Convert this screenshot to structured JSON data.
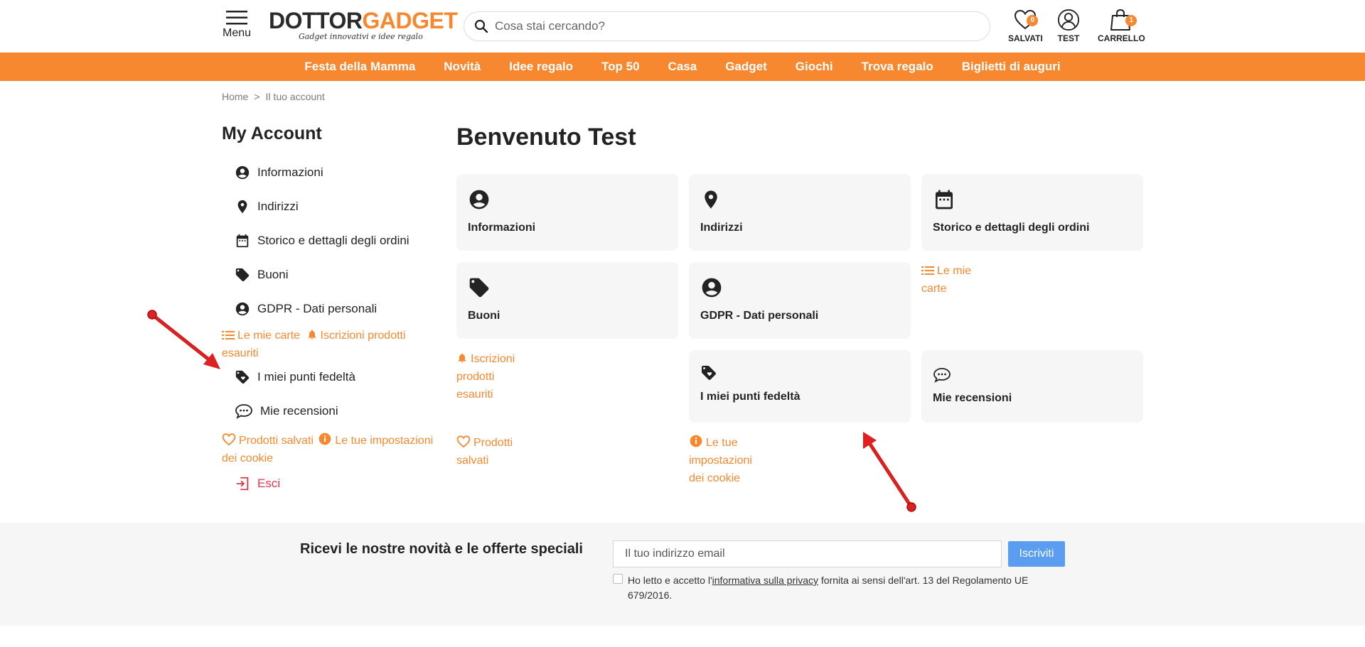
{
  "header": {
    "menu_label": "Menu",
    "logo": {
      "part1": "DOTTOR",
      "part2": "GADGET",
      "tagline": "Gadget innovativi e idee regalo"
    },
    "search_placeholder": "Cosa stai cercando?",
    "saved": {
      "label": "SALVATI",
      "count": "0"
    },
    "account": {
      "label": "TEST"
    },
    "cart": {
      "label": "CARRELLO",
      "count": "1"
    }
  },
  "nav": {
    "items": [
      "Festa della Mamma",
      "Novità",
      "Idee regalo",
      "Top 50",
      "Casa",
      "Gadget",
      "Giochi",
      "Trova regalo",
      "Biglietti di auguri"
    ]
  },
  "breadcrumb": {
    "home": "Home",
    "separator": ">",
    "current": "Il tuo account"
  },
  "sidebar": {
    "title": "My Account",
    "items": [
      {
        "label": "Informazioni",
        "icon": "account-circle-icon"
      },
      {
        "label": "Indirizzi",
        "icon": "location-pin-icon"
      },
      {
        "label": "Storico e dettagli degli ordini",
        "icon": "calendar-icon"
      },
      {
        "label": "Buoni",
        "icon": "tag-icon"
      },
      {
        "label": "GDPR - Dati personali",
        "icon": "account-circle-icon"
      }
    ],
    "cards_link": "Le mie carte",
    "subscriptions_link": "Iscrizioni prodotti esauriti",
    "loyalty": "I miei punti fedeltà",
    "reviews": "Mie recensioni",
    "saved_products": "Prodotti salvati",
    "cookie_settings": "Le tue impostazioni dei cookie",
    "logout": "Esci"
  },
  "main": {
    "welcome": "Benvenuto Test",
    "cards": {
      "info": "Informazioni",
      "addresses": "Indirizzi",
      "orders": "Storico e dettagli degli ordini",
      "vouchers": "Buoni",
      "gdpr": "GDPR - Dati personali",
      "loyalty": "I miei punti fedeltà",
      "reviews": "Mie recensioni"
    },
    "links": {
      "cards_line1": "Le mie",
      "cards_line2": "carte",
      "subs_line1": "Iscrizioni",
      "subs_line2": "prodotti",
      "subs_line3": "esauriti",
      "saved_line1": "Prodotti",
      "saved_line2": "salvati",
      "cookie_line1": "Le tue",
      "cookie_line2": "impostazioni",
      "cookie_line3": "dei cookie"
    }
  },
  "newsletter": {
    "title": "Ricevi le nostre novità e le offerte speciali",
    "email_placeholder": "Il tuo indirizzo email",
    "subscribe_label": "Iscriviti",
    "consent_before": "Ho letto e accetto l'",
    "consent_link": "informativa sulla privacy",
    "consent_after": " fornita ai sensi dell'art. 13 del Regolamento UE 679/2016."
  },
  "colors": {
    "accent": "#f7882f",
    "exit": "#e0364e",
    "subscribe_button": "#5b9df0",
    "card_background": "#f6f6f6",
    "annotation_arrow": "#e02020"
  }
}
